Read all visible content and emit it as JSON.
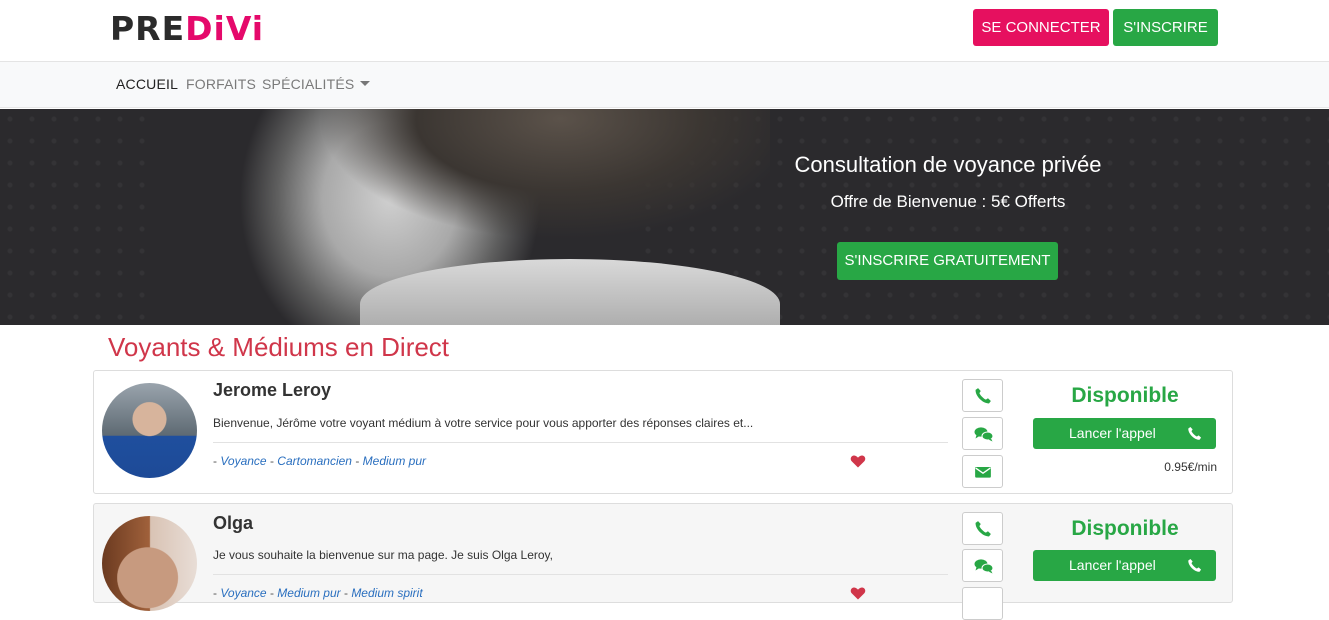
{
  "header": {
    "logo_part1": "PRE",
    "logo_part2": "DiVi",
    "login_label": "SE CONNECTER",
    "register_label": "S'INSCRIRE"
  },
  "nav": {
    "home": "ACCUEIL",
    "plans": "FORFAITS",
    "specialties": "SPÉCIALITÉS"
  },
  "hero": {
    "title": "Consultation de voyance privée",
    "subtitle": "Offre de Bienvenue : 5€ Offerts",
    "cta": "S'INSCRIRE GRATUITEMENT"
  },
  "section_title": "Voyants & Médiums en Direct",
  "colors": {
    "brand": "#e5096b",
    "success": "#28a745",
    "heading": "#d0364a"
  },
  "cards": [
    {
      "name": "Jerome Leroy",
      "description": "Bienvenue, Jérôme votre voyant médium à votre service pour vous apporter des réponses claires et...",
      "tag1": "Voyance",
      "tag2": "Cartomancien",
      "tag3": "Medium pur",
      "status": "Disponible",
      "call_label": "Lancer l'appel",
      "price": "0.95€/min"
    },
    {
      "name": "Olga",
      "description": "Je vous souhaite la bienvenue sur ma page. Je suis Olga Leroy,",
      "tag1": "Voyance",
      "tag2": "Medium pur",
      "tag3": "Medium spirit",
      "status": "Disponible",
      "call_label": "Lancer l'appel"
    }
  ]
}
